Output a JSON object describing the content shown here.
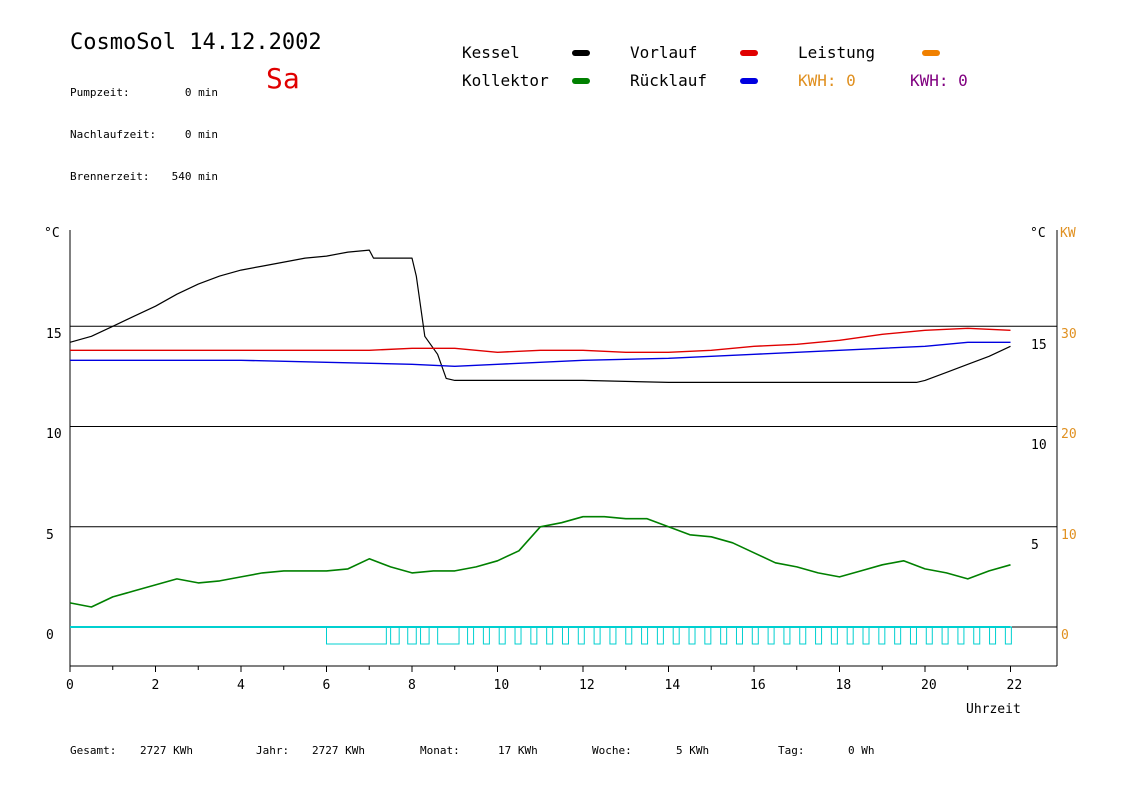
{
  "header": {
    "title": "CosmoSol 14.12.2002",
    "day": "Sa",
    "stats": [
      {
        "label": "Pumpzeit:",
        "value": "0 min"
      },
      {
        "label": "Nachlaufzeit:",
        "value": "0 min"
      },
      {
        "label": "Brennerzeit:",
        "value": "540 min"
      }
    ]
  },
  "legend": {
    "kessel": "Kessel",
    "kollektor": "Kollektor",
    "vorlauf": "Vorlauf",
    "ruecklauf": "Rücklauf",
    "leistung": "Leistung",
    "kwh1": "KWH: 0",
    "kwh2": "KWH: 0"
  },
  "colors": {
    "kessel": "#000000",
    "kollektor": "#008000",
    "vorlauf": "#e00000",
    "ruecklauf": "#0000e0",
    "leistung": "#f08000",
    "kwh1": "#e09020",
    "kwh2": "#800080",
    "pump": "#00d0d0"
  },
  "chart_data": {
    "type": "line",
    "xlabel": "Uhrzeit",
    "xlim": [
      0,
      23
    ],
    "ylim": [
      -1,
      19
    ],
    "x_ticks": [
      "0",
      "2",
      "4",
      "6",
      "8",
      "10",
      "12",
      "14",
      "16",
      "18",
      "20",
      "22"
    ],
    "left_unit": "°C",
    "right_unit": "°C",
    "kw_unit": "KW",
    "left_ticks": [
      "0",
      "5",
      "10",
      "15"
    ],
    "right_ticks": [
      "5",
      "10",
      "15"
    ],
    "kw_ticks": [
      "0",
      "10",
      "20",
      "30"
    ],
    "series": [
      {
        "key": "kessel",
        "points": [
          [
            0,
            14.2
          ],
          [
            0.5,
            14.5
          ],
          [
            1,
            15
          ],
          [
            1.5,
            15.5
          ],
          [
            2,
            16
          ],
          [
            2.5,
            16.6
          ],
          [
            3,
            17.1
          ],
          [
            3.5,
            17.5
          ],
          [
            4,
            17.8
          ],
          [
            4.5,
            18
          ],
          [
            5,
            18.2
          ],
          [
            5.5,
            18.4
          ],
          [
            6,
            18.5
          ],
          [
            6.5,
            18.7
          ],
          [
            7,
            18.8
          ],
          [
            7.1,
            18.4
          ],
          [
            7.5,
            18.4
          ],
          [
            8,
            18.4
          ],
          [
            8.1,
            17.5
          ],
          [
            8.3,
            14.5
          ],
          [
            8.6,
            13.6
          ],
          [
            8.8,
            12.4
          ],
          [
            9,
            12.3
          ],
          [
            10,
            12.3
          ],
          [
            12,
            12.3
          ],
          [
            14,
            12.2
          ],
          [
            16,
            12.2
          ],
          [
            18,
            12.2
          ],
          [
            19.8,
            12.2
          ],
          [
            20,
            12.3
          ],
          [
            20.5,
            12.7
          ],
          [
            21,
            13.1
          ],
          [
            21.5,
            13.5
          ],
          [
            22,
            14
          ]
        ]
      },
      {
        "key": "vorlauf",
        "points": [
          [
            0,
            13.8
          ],
          [
            2,
            13.8
          ],
          [
            4,
            13.8
          ],
          [
            6,
            13.8
          ],
          [
            7,
            13.8
          ],
          [
            8,
            13.9
          ],
          [
            9,
            13.9
          ],
          [
            10,
            13.7
          ],
          [
            11,
            13.8
          ],
          [
            12,
            13.8
          ],
          [
            13,
            13.7
          ],
          [
            14,
            13.7
          ],
          [
            15,
            13.8
          ],
          [
            16,
            14
          ],
          [
            17,
            14.1
          ],
          [
            18,
            14.3
          ],
          [
            19,
            14.6
          ],
          [
            20,
            14.8
          ],
          [
            21,
            14.9
          ],
          [
            22,
            14.8
          ]
        ]
      },
      {
        "key": "ruecklauf",
        "points": [
          [
            0,
            13.3
          ],
          [
            2,
            13.3
          ],
          [
            4,
            13.3
          ],
          [
            6,
            13.2
          ],
          [
            8,
            13.1
          ],
          [
            9,
            13.0
          ],
          [
            10,
            13.1
          ],
          [
            12,
            13.3
          ],
          [
            14,
            13.4
          ],
          [
            15,
            13.5
          ],
          [
            16,
            13.6
          ],
          [
            17,
            13.7
          ],
          [
            18,
            13.8
          ],
          [
            19,
            13.9
          ],
          [
            20,
            14.0
          ],
          [
            21,
            14.2
          ],
          [
            22,
            14.2
          ]
        ]
      },
      {
        "key": "kollektor",
        "points": [
          [
            0,
            1.2
          ],
          [
            0.5,
            1.0
          ],
          [
            1,
            1.5
          ],
          [
            1.5,
            1.8
          ],
          [
            2,
            2.1
          ],
          [
            2.5,
            2.4
          ],
          [
            3,
            2.2
          ],
          [
            3.5,
            2.3
          ],
          [
            4,
            2.5
          ],
          [
            4.5,
            2.7
          ],
          [
            5,
            2.8
          ],
          [
            5.5,
            2.8
          ],
          [
            6,
            2.8
          ],
          [
            6.5,
            2.9
          ],
          [
            7,
            3.4
          ],
          [
            7.5,
            3.0
          ],
          [
            8,
            2.7
          ],
          [
            8.5,
            2.8
          ],
          [
            9,
            2.8
          ],
          [
            9.5,
            3.0
          ],
          [
            10,
            3.3
          ],
          [
            10.5,
            3.8
          ],
          [
            11,
            5.0
          ],
          [
            11.5,
            5.2
          ],
          [
            12,
            5.5
          ],
          [
            12.5,
            5.5
          ],
          [
            13,
            5.4
          ],
          [
            13.5,
            5.4
          ],
          [
            14,
            5.0
          ],
          [
            14.5,
            4.6
          ],
          [
            15,
            4.5
          ],
          [
            15.5,
            4.2
          ],
          [
            16,
            3.7
          ],
          [
            16.5,
            3.2
          ],
          [
            17,
            3.0
          ],
          [
            17.5,
            2.7
          ],
          [
            18,
            2.5
          ],
          [
            18.5,
            2.8
          ],
          [
            19,
            3.1
          ],
          [
            19.5,
            3.3
          ],
          [
            20,
            2.9
          ],
          [
            20.5,
            2.7
          ],
          [
            21,
            2.4
          ],
          [
            21.5,
            2.8
          ],
          [
            22,
            3.1
          ]
        ]
      }
    ],
    "pump_segments": [
      [
        6,
        7.4
      ],
      [
        7.5,
        7.7
      ],
      [
        7.9,
        8.1
      ],
      [
        8.2,
        8.4
      ],
      [
        8.6,
        9.1
      ]
    ]
  },
  "footer": [
    {
      "label": "Gesamt:",
      "value": "2727 KWh"
    },
    {
      "label": "Jahr:",
      "value": "2727 KWh"
    },
    {
      "label": "Monat:",
      "value": "17 KWh"
    },
    {
      "label": "Woche:",
      "value": "5 KWh"
    },
    {
      "label": "Tag:",
      "value": "0 Wh"
    }
  ]
}
